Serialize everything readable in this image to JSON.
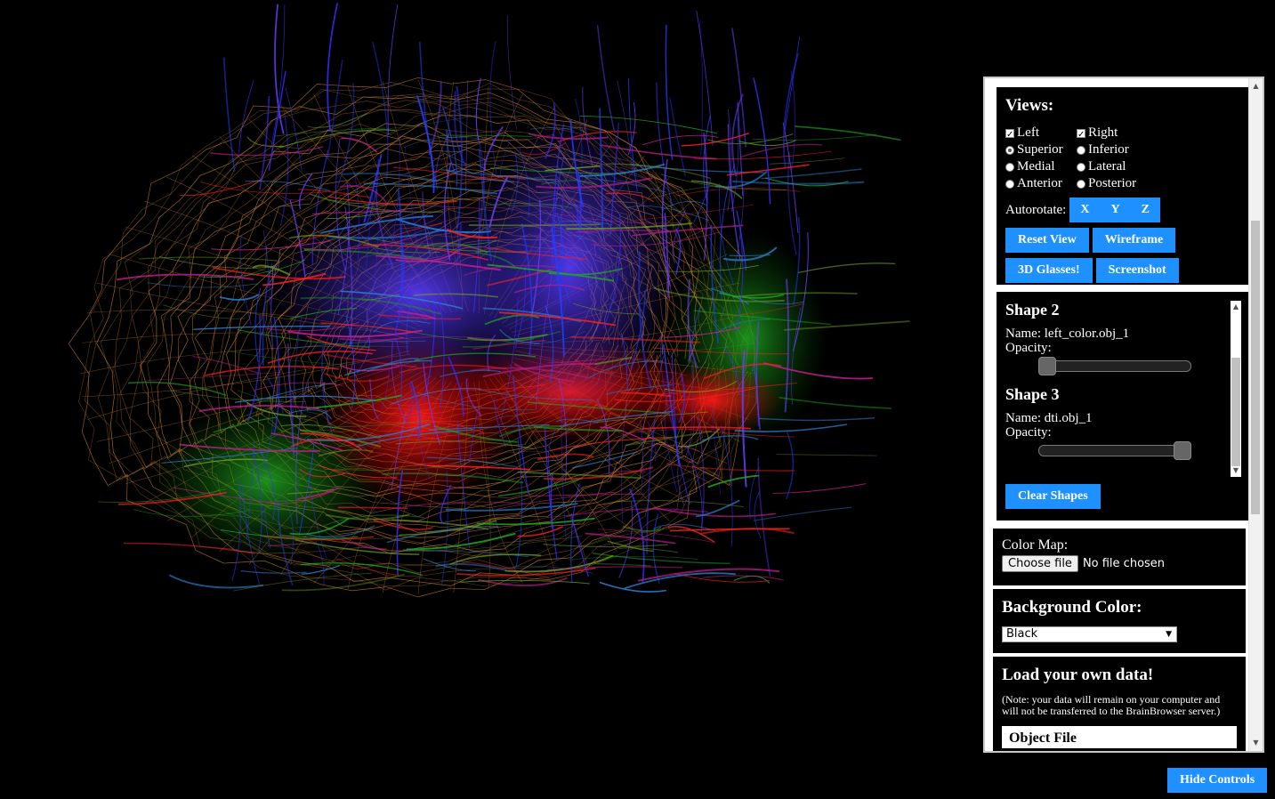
{
  "views": {
    "title": "Views:",
    "options": [
      {
        "label": "Left",
        "type": "checkbox",
        "checked": true
      },
      {
        "label": "Right",
        "type": "checkbox",
        "checked": true
      },
      {
        "label": "Superior",
        "type": "radio",
        "checked": true
      },
      {
        "label": "Inferior",
        "type": "radio",
        "checked": false
      },
      {
        "label": "Medial",
        "type": "radio",
        "checked": false
      },
      {
        "label": "Lateral",
        "type": "radio",
        "checked": false
      },
      {
        "label": "Anterior",
        "type": "radio",
        "checked": false
      },
      {
        "label": "Posterior",
        "type": "radio",
        "checked": false
      }
    ],
    "autorotate_label": "Autorotate:",
    "axis_x": "X",
    "axis_y": "Y",
    "axis_z": "Z",
    "reset_view": "Reset View",
    "wireframe": "Wireframe",
    "glasses": "3D Glasses!",
    "screenshot": "Screenshot"
  },
  "shapes": {
    "items": [
      {
        "title": "Shape 2",
        "name_label": "Name: left_color.obj_1",
        "opacity_label": "Opacity:",
        "opacity": 0.0
      },
      {
        "title": "Shape 3",
        "name_label": "Name: dti.obj_1",
        "opacity_label": "Opacity:",
        "opacity": 1.0
      }
    ],
    "clear": "Clear Shapes"
  },
  "color_map": {
    "label": "Color Map:",
    "choose": "Choose file",
    "status": "No file chosen"
  },
  "background": {
    "title": "Background Color:",
    "selected": "Black"
  },
  "load": {
    "title": "Load your own data!",
    "note": "(Note: your data will remain on your computer and will not be transferred to the BrainBrowser server.)",
    "section": "Object File"
  },
  "hide_controls": "Hide Controls",
  "colors": {
    "accent": "#1e90ff",
    "background": "#000000",
    "wireframe": "#d4892a"
  }
}
